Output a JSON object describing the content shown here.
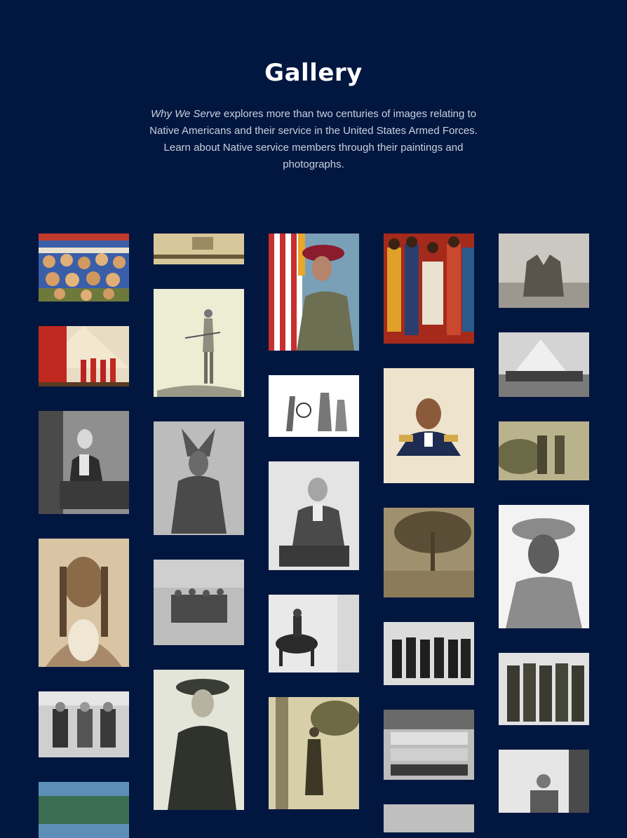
{
  "header": {
    "title": "Gallery",
    "intro_italic": "Why We Serve",
    "intro_rest": " explores more than two centuries of images relating to Native Americans and their service in the United States Armed Forces. Learn about Native service members through their paintings and photographs."
  },
  "colors": {
    "background": "#021740",
    "text": "#ffffff",
    "muted": "#c9d0dd"
  }
}
